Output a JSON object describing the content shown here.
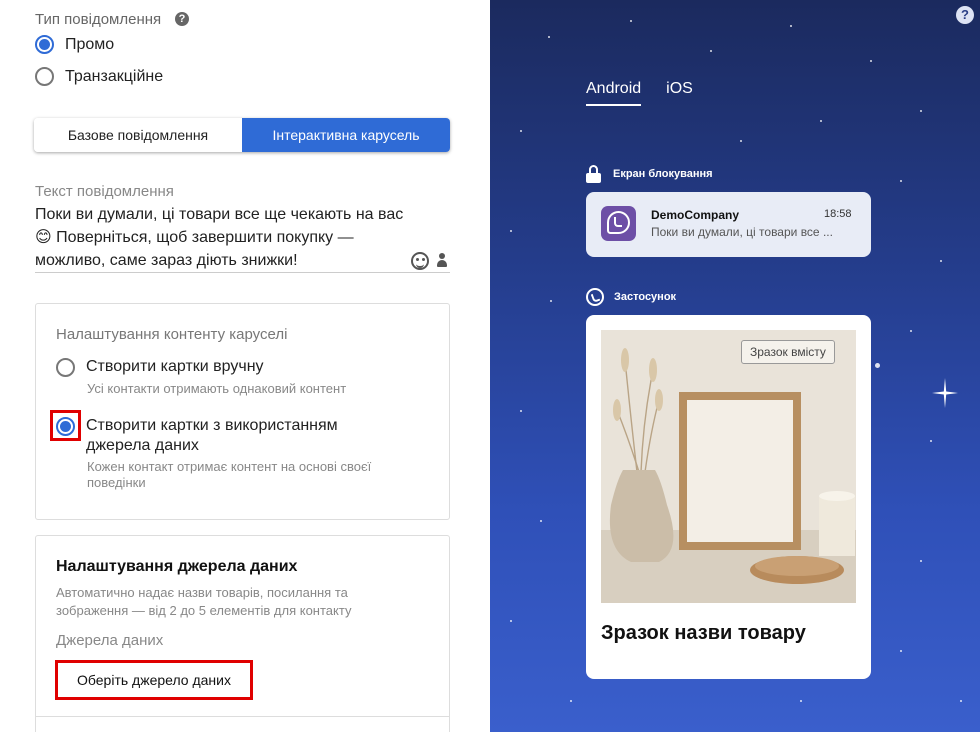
{
  "message_type": {
    "label": "Тип повідомлення",
    "help_icon": "?",
    "options": [
      {
        "label": "Промо",
        "selected": true
      },
      {
        "label": "Транзакційне",
        "selected": false
      }
    ]
  },
  "format_tabs": [
    {
      "label": "Базове повідомлення",
      "active": false
    },
    {
      "label": "Інтерактивна карусель",
      "active": true
    }
  ],
  "message_text": {
    "label": "Текст повідомлення",
    "value": "Поки ви думали, ці товари все ще чекають на вас 😊 Поверніться, щоб завершити покупку — можливо, саме зараз діють знижки!"
  },
  "carousel_settings": {
    "heading": "Налаштування контенту каруселі",
    "options": [
      {
        "label": "Створити картки вручну",
        "sub": "Усі контакти отримають однаковий контент",
        "selected": false
      },
      {
        "label": "Створити картки з використанням джерела даних",
        "sub": "Кожен контакт отримає контент на основі своєї поведінки",
        "selected": true
      }
    ]
  },
  "datasource": {
    "title": "Налаштування джерела даних",
    "description": "Автоматично надає назви товарів, посилання та зображення — від 2 до 5 елементів для контакту",
    "label": "Джерела даних",
    "button": "Оберіть джерело даних"
  },
  "preview": {
    "help_icon": "?",
    "tabs": [
      {
        "label": "Android",
        "active": true
      },
      {
        "label": "iOS",
        "active": false
      }
    ],
    "lock_screen": {
      "label": "Екран блокування",
      "sender": "DemoCompany",
      "time": "18:58",
      "preview": "Поки ви думали, ці товари все ..."
    },
    "app": {
      "label": "Застосунок",
      "badge": "Зразок вмісту",
      "product_title": "Зразок назви товару"
    }
  },
  "colors": {
    "accent": "#2f6bd6",
    "highlight": "#e00000",
    "viber": "#6d4fa6"
  }
}
